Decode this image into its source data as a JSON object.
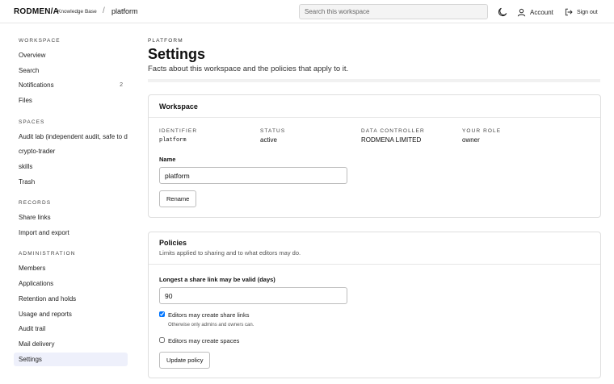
{
  "header": {
    "brand": "RODMEN/A",
    "brand_sub": "Knowledge Base",
    "separator": "/",
    "workspace": "platform",
    "search_placeholder": "Search this workspace",
    "account_label": "Account",
    "signout_label": "Sign out"
  },
  "sidebar": {
    "workspace": {
      "heading": "WORKSPACE",
      "items": [
        {
          "label": "Overview"
        },
        {
          "label": "Search"
        },
        {
          "label": "Notifications",
          "count": "2"
        },
        {
          "label": "Files"
        }
      ]
    },
    "spaces": {
      "heading": "SPACES",
      "items": [
        {
          "label": "Audit lab (independent audit, safe to de"
        },
        {
          "label": "crypto-trader"
        },
        {
          "label": "skills"
        },
        {
          "label": "Trash"
        }
      ]
    },
    "records": {
      "heading": "RECORDS",
      "items": [
        {
          "label": "Share links"
        },
        {
          "label": "Import and export"
        }
      ]
    },
    "administration": {
      "heading": "ADMINISTRATION",
      "items": [
        {
          "label": "Members"
        },
        {
          "label": "Applications"
        },
        {
          "label": "Retention and holds"
        },
        {
          "label": "Usage and reports"
        },
        {
          "label": "Audit trail"
        },
        {
          "label": "Mail delivery"
        },
        {
          "label": "Settings",
          "active": true
        }
      ]
    }
  },
  "page": {
    "kicker": "PLATFORM",
    "title": "Settings",
    "subtitle": "Facts about this workspace and the policies that apply to it."
  },
  "workspace_card": {
    "title": "Workspace",
    "facts": [
      {
        "label": "IDENTIFIER",
        "value": "platform"
      },
      {
        "label": "STATUS",
        "value": "active"
      },
      {
        "label": "DATA CONTROLLER",
        "value": "RODMENA LIMITED"
      },
      {
        "label": "YOUR ROLE",
        "value": "owner"
      }
    ],
    "name_label": "Name",
    "name_value": "platform",
    "rename_label": "Rename"
  },
  "policies_card": {
    "title": "Policies",
    "description": "Limits applied to sharing and to what editors may do.",
    "share_days_label": "Longest a share link may be valid (days)",
    "share_days_value": "90",
    "editors_share_label": "Editors may create share links",
    "editors_share_checked": true,
    "editors_share_help": "Otherwise only admins and owners can.",
    "editors_spaces_label": "Editors may create spaces",
    "editors_spaces_checked": false,
    "update_label": "Update policy"
  }
}
